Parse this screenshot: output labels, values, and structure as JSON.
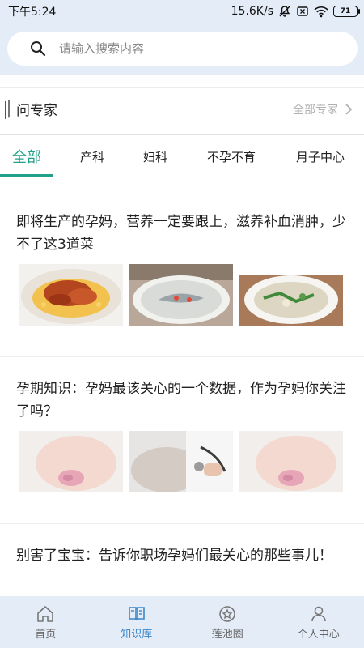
{
  "status_bar": {
    "time": "下午5:24",
    "speed": "15.6K/s",
    "battery": "71"
  },
  "search": {
    "placeholder": "请输入搜索内容"
  },
  "expert": {
    "title": "问专家",
    "more": "全部专家"
  },
  "tabs": [
    "全部",
    "产科",
    "妇科",
    "不孕不育",
    "月子中心"
  ],
  "active_tab": "全部",
  "articles": [
    {
      "title": "即将生产的孕妈，营养一定要跟上，滋养补血消肿，少不了这3道菜"
    },
    {
      "title": "孕期知识：孕妈最该关心的一个数据，作为孕妈你关注了吗？"
    },
    {
      "title": "别害了宝宝：告诉你职场孕妈们最关心的那些事儿！"
    }
  ],
  "nav": [
    {
      "label": "首页",
      "icon": "home-icon"
    },
    {
      "label": "知识库",
      "icon": "book-icon"
    },
    {
      "label": "莲池圈",
      "icon": "lotus-circle-icon"
    },
    {
      "label": "个人中心",
      "icon": "person-icon"
    }
  ],
  "colors": {
    "accent": "#21a18a",
    "nav_active": "#3a86c8",
    "header_bg": "#e3ecf7"
  }
}
